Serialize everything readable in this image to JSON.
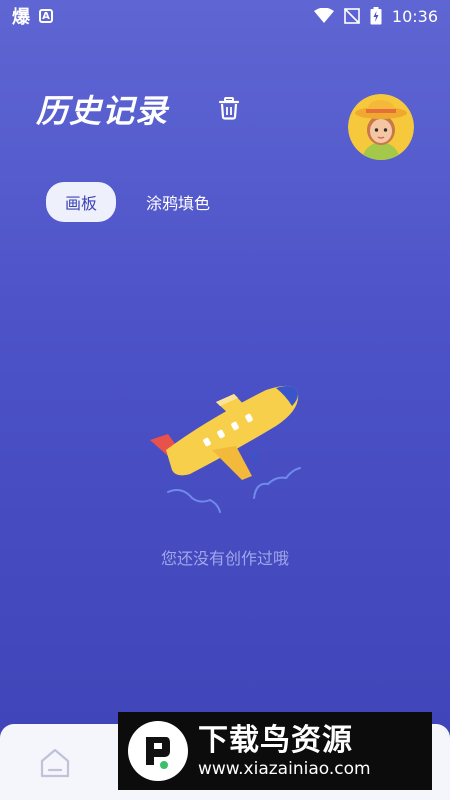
{
  "status_bar": {
    "app_icon_text": "爆",
    "a_icon_text": "A",
    "time": "10:36"
  },
  "header": {
    "title": "历史记录"
  },
  "tabs": [
    {
      "label": "画板",
      "active": true
    },
    {
      "label": "涂鸦填色",
      "active": false
    }
  ],
  "empty_state": {
    "message": "您还没有创作过哦"
  },
  "watermark": {
    "title": "下载鸟资源",
    "url": "www.xiazainiao.com"
  },
  "colors": {
    "bg_top": "#5f66d3",
    "bg_bottom": "#3e44b6",
    "tab_active_bg": "#eef0fb",
    "tab_active_text": "#3e44b6",
    "plane_yellow": "#f7cf4a",
    "plane_tail": "#e8524a"
  },
  "icons": {
    "trash": "trash-icon",
    "home": "home-icon",
    "wifi": "wifi-icon",
    "battery": "battery-icon",
    "signal": "no-signal-icon"
  }
}
